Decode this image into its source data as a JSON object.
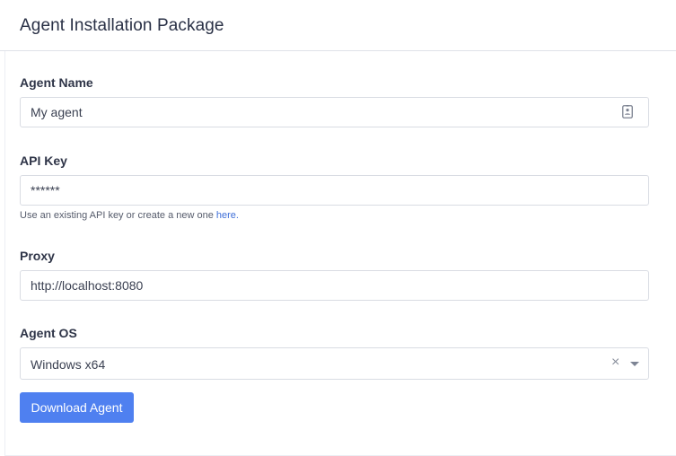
{
  "header": {
    "title": "Agent Installation Package"
  },
  "form": {
    "agent_name": {
      "label": "Agent Name",
      "value": "My agent",
      "icon": "contact-card-icon"
    },
    "api_key": {
      "label": "API Key",
      "value": "******",
      "help_text": "Use an existing API key or create a new one ",
      "help_link": "here."
    },
    "proxy": {
      "label": "Proxy",
      "value": "http://localhost:8080"
    },
    "agent_os": {
      "label": "Agent OS",
      "selected": "Windows x64",
      "clear_glyph": "×"
    },
    "download_button": "Download Agent"
  },
  "colors": {
    "primary": "#4f80f0",
    "link": "#3f6fd8",
    "border": "#d9dce3",
    "title": "#2a3146"
  }
}
